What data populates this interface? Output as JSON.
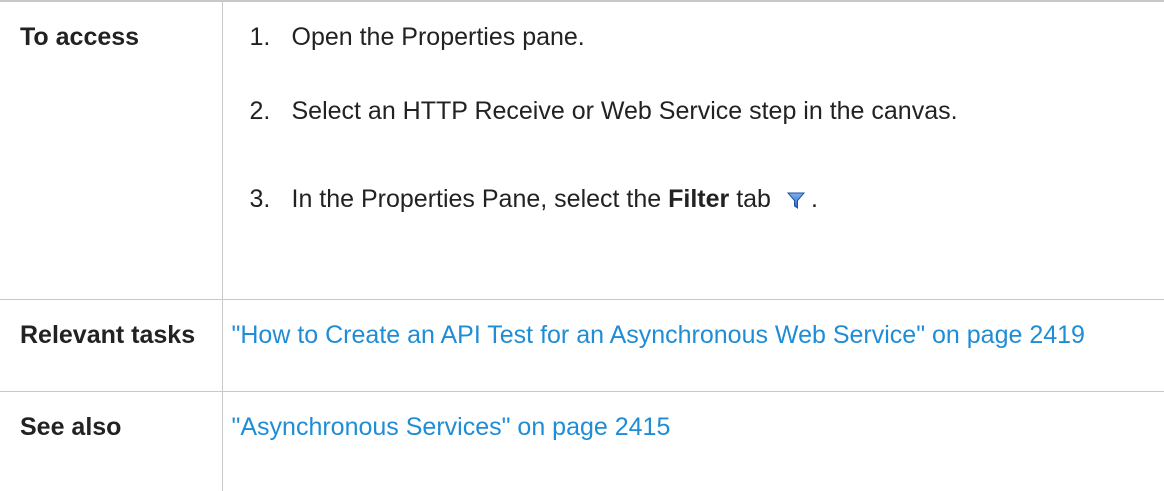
{
  "table": {
    "rows": [
      {
        "header": "To access",
        "steps": [
          {
            "number": "1.",
            "text": "Open the Properties pane."
          },
          {
            "number": "2.",
            "text": "Select an HTTP Receive or Web Service step in the canvas."
          },
          {
            "number": "3.",
            "text_before": "In the Properties Pane, select the ",
            "bold": "Filter",
            "text_after": " tab",
            "icon": "filter-funnel-icon",
            "trailing": "."
          }
        ]
      },
      {
        "header": "Relevant tasks",
        "link": "\"How to Create an API Test for an Asynchronous Web Service\" on page 2419"
      },
      {
        "header": "See also",
        "link": "\"Asynchronous Services\" on page 2415"
      }
    ]
  },
  "colors": {
    "link": "#1f8dd6",
    "border": "#c8c8c8",
    "icon_blue": "#3b7dd8"
  }
}
